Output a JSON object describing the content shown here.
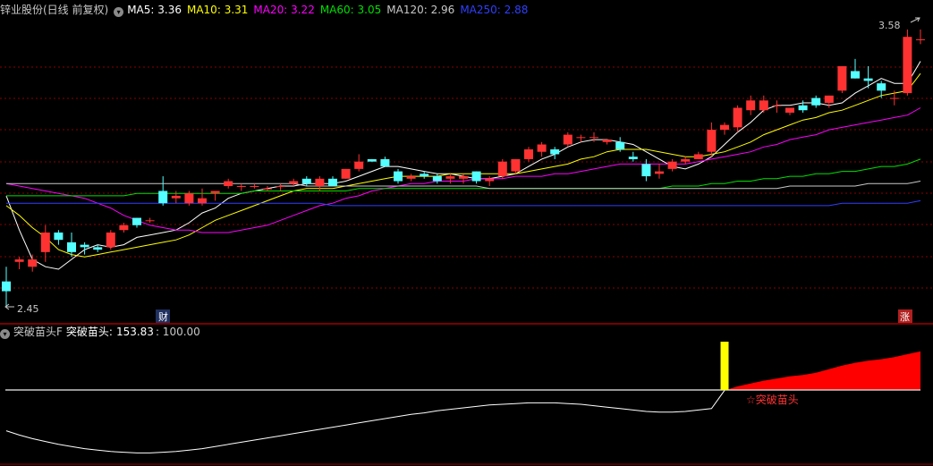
{
  "main_header": {
    "title": "锌业股份(日线 前复权)",
    "indicators": [
      {
        "label": "MA5:",
        "value": "3.36",
        "color": "#ffffff"
      },
      {
        "label": "MA10:",
        "value": "3.31",
        "color": "#ffff00"
      },
      {
        "label": "MA20:",
        "value": "3.22",
        "color": "#ff00ff"
      },
      {
        "label": "MA60:",
        "value": "3.05",
        "color": "#00e000"
      },
      {
        "label": "MA120:",
        "value": "2.96",
        "color": "#c8c8c8"
      },
      {
        "label": "MA250:",
        "value": "2.88",
        "color": "#2f3fff"
      }
    ]
  },
  "sub_header": {
    "name": "突破苗头F",
    "series_label": "突破苗头:",
    "value": "153.83",
    "ref_value": ": 100.00"
  },
  "markers": {
    "high_label": "3.58",
    "low_label": "2.45",
    "finance_badge": "财",
    "limit_up_badge": "涨",
    "signal_label": "☆突破苗头"
  },
  "colors": {
    "up": "#ff3232",
    "down": "#54ffff",
    "grid": "#8b0000",
    "separator": "#a00000",
    "signal_bar": "#ffff00",
    "area": "#ff0000"
  },
  "chart_data": [
    {
      "type": "candlestick",
      "title": "锌业股份(日线 前复权)",
      "ylim": [
        2.45,
        3.58
      ],
      "candles": [
        [
          2.55,
          2.61,
          2.45,
          2.51
        ],
        [
          2.63,
          2.65,
          2.6,
          2.64
        ],
        [
          2.61,
          2.66,
          2.59,
          2.64
        ],
        [
          2.67,
          2.78,
          2.63,
          2.75
        ],
        [
          2.75,
          2.76,
          2.7,
          2.72
        ],
        [
          2.71,
          2.75,
          2.65,
          2.67
        ],
        [
          2.7,
          2.71,
          2.66,
          2.69
        ],
        [
          2.69,
          2.7,
          2.67,
          2.68
        ],
        [
          2.69,
          2.76,
          2.68,
          2.75
        ],
        [
          2.76,
          2.79,
          2.75,
          2.78
        ],
        [
          2.81,
          2.81,
          2.77,
          2.78
        ],
        [
          2.8,
          2.81,
          2.79,
          2.8
        ],
        [
          2.92,
          2.98,
          2.86,
          2.87
        ],
        [
          2.89,
          2.92,
          2.87,
          2.9
        ],
        [
          2.87,
          2.92,
          2.86,
          2.91
        ],
        [
          2.87,
          2.93,
          2.86,
          2.89
        ],
        [
          2.91,
          2.92,
          2.88,
          2.92
        ],
        [
          2.94,
          2.97,
          2.93,
          2.96
        ],
        [
          2.94,
          2.95,
          2.92,
          2.94
        ],
        [
          2.94,
          2.95,
          2.93,
          2.94
        ],
        [
          2.93,
          2.94,
          2.92,
          2.93
        ],
        [
          2.94,
          2.95,
          2.92,
          2.94
        ],
        [
          2.95,
          2.97,
          2.94,
          2.96
        ],
        [
          2.97,
          2.98,
          2.94,
          2.95
        ],
        [
          2.94,
          2.98,
          2.92,
          2.97
        ],
        [
          2.97,
          2.98,
          2.95,
          2.94
        ],
        [
          2.97,
          3.01,
          2.97,
          3.01
        ],
        [
          3.01,
          3.07,
          3.0,
          3.04
        ],
        [
          3.05,
          3.05,
          3.04,
          3.04
        ],
        [
          3.05,
          3.06,
          3.02,
          3.02
        ],
        [
          3.0,
          3.01,
          2.95,
          2.96
        ],
        [
          2.97,
          2.99,
          2.96,
          2.98
        ],
        [
          2.99,
          3.0,
          2.97,
          2.98
        ],
        [
          2.98,
          2.99,
          2.95,
          2.96
        ],
        [
          2.97,
          2.99,
          2.95,
          2.98
        ],
        [
          2.97,
          2.99,
          2.95,
          2.98
        ],
        [
          3.0,
          3.0,
          2.95,
          2.96
        ],
        [
          2.96,
          2.98,
          2.94,
          2.97
        ],
        [
          2.98,
          3.05,
          2.97,
          3.04
        ],
        [
          3.0,
          3.05,
          2.99,
          3.05
        ],
        [
          3.05,
          3.1,
          3.04,
          3.09
        ],
        [
          3.08,
          3.12,
          3.06,
          3.11
        ],
        [
          3.09,
          3.1,
          3.05,
          3.07
        ],
        [
          3.11,
          3.16,
          3.1,
          3.15
        ],
        [
          3.14,
          3.15,
          3.12,
          3.14
        ],
        [
          3.14,
          3.16,
          3.12,
          3.14
        ],
        [
          3.12,
          3.13,
          3.11,
          3.13
        ],
        [
          3.12,
          3.14,
          3.08,
          3.09
        ],
        [
          3.06,
          3.08,
          3.04,
          3.05
        ],
        [
          3.03,
          3.05,
          2.96,
          2.98
        ],
        [
          2.99,
          3.03,
          2.97,
          3.0
        ],
        [
          3.01,
          3.05,
          3.0,
          3.04
        ],
        [
          3.04,
          3.06,
          3.03,
          3.05
        ],
        [
          3.05,
          3.08,
          3.05,
          3.07
        ],
        [
          3.08,
          3.2,
          3.06,
          3.17
        ],
        [
          3.17,
          3.2,
          3.15,
          3.19
        ],
        [
          3.18,
          3.27,
          3.16,
          3.26
        ],
        [
          3.25,
          3.31,
          3.23,
          3.29
        ],
        [
          3.25,
          3.31,
          3.24,
          3.29
        ],
        [
          3.27,
          3.29,
          3.24,
          3.27
        ],
        [
          3.24,
          3.26,
          3.23,
          3.26
        ],
        [
          3.27,
          3.29,
          3.24,
          3.25
        ],
        [
          3.3,
          3.31,
          3.26,
          3.27
        ],
        [
          3.28,
          3.31,
          3.26,
          3.31
        ],
        [
          3.33,
          3.43,
          3.32,
          3.43
        ],
        [
          3.41,
          3.46,
          3.38,
          3.38
        ],
        [
          3.38,
          3.43,
          3.34,
          3.37
        ],
        [
          3.36,
          3.37,
          3.3,
          3.33
        ],
        [
          3.3,
          3.33,
          3.27,
          3.3
        ],
        [
          3.32,
          3.58,
          3.31,
          3.55
        ],
        [
          3.54,
          3.58,
          3.52,
          3.54
        ]
      ],
      "series": [
        {
          "name": "MA5",
          "values": [
            2.9,
            2.76,
            2.64,
            2.61,
            2.6,
            2.64,
            2.68,
            2.7,
            2.69,
            2.7,
            2.73,
            2.74,
            2.75,
            2.76,
            2.79,
            2.83,
            2.85,
            2.89,
            2.91,
            2.92,
            2.93,
            2.94,
            2.94,
            2.95,
            2.95,
            2.95,
            2.96,
            2.98,
            3.0,
            3.02,
            3.02,
            3.01,
            3.0,
            2.99,
            2.99,
            2.98,
            2.97,
            2.97,
            2.98,
            2.99,
            3.02,
            3.05,
            3.07,
            3.1,
            3.12,
            3.13,
            3.13,
            3.12,
            3.11,
            3.08,
            3.05,
            3.02,
            3.01,
            3.03,
            3.06,
            3.11,
            3.16,
            3.2,
            3.25,
            3.27,
            3.27,
            3.28,
            3.28,
            3.27,
            3.28,
            3.32,
            3.35,
            3.38,
            3.36,
            3.36,
            3.45
          ]
        },
        {
          "name": "MA10",
          "values": [
            2.86,
            2.82,
            2.77,
            2.73,
            2.68,
            2.66,
            2.65,
            2.66,
            2.67,
            2.68,
            2.69,
            2.7,
            2.71,
            2.72,
            2.74,
            2.77,
            2.8,
            2.82,
            2.84,
            2.86,
            2.88,
            2.9,
            2.92,
            2.93,
            2.93,
            2.93,
            2.94,
            2.95,
            2.96,
            2.97,
            2.98,
            2.98,
            2.98,
            2.98,
            2.99,
            2.99,
            2.99,
            2.99,
            2.99,
            2.99,
            3.0,
            3.01,
            3.02,
            3.03,
            3.05,
            3.06,
            3.08,
            3.09,
            3.09,
            3.09,
            3.08,
            3.07,
            3.06,
            3.06,
            3.07,
            3.08,
            3.1,
            3.12,
            3.15,
            3.17,
            3.19,
            3.21,
            3.22,
            3.24,
            3.25,
            3.27,
            3.29,
            3.31,
            3.32,
            3.33,
            3.4
          ]
        },
        {
          "name": "MA20",
          "values": [
            2.95,
            2.94,
            2.93,
            2.92,
            2.91,
            2.9,
            2.89,
            2.87,
            2.85,
            2.82,
            2.8,
            2.78,
            2.77,
            2.76,
            2.76,
            2.75,
            2.75,
            2.75,
            2.76,
            2.77,
            2.78,
            2.8,
            2.82,
            2.84,
            2.86,
            2.87,
            2.89,
            2.9,
            2.92,
            2.93,
            2.94,
            2.95,
            2.95,
            2.96,
            2.96,
            2.96,
            2.97,
            2.97,
            2.97,
            2.98,
            2.98,
            2.98,
            2.99,
            2.99,
            3.0,
            3.01,
            3.02,
            3.03,
            3.03,
            3.03,
            3.03,
            3.03,
            3.03,
            3.04,
            3.05,
            3.06,
            3.07,
            3.08,
            3.1,
            3.11,
            3.13,
            3.14,
            3.15,
            3.17,
            3.18,
            3.19,
            3.2,
            3.21,
            3.22,
            3.23,
            3.26
          ]
        },
        {
          "name": "MA60",
          "values": [
            2.9,
            2.9,
            2.9,
            2.9,
            2.9,
            2.9,
            2.9,
            2.9,
            2.9,
            2.9,
            2.91,
            2.91,
            2.91,
            2.91,
            2.91,
            2.91,
            2.91,
            2.91,
            2.91,
            2.92,
            2.92,
            2.92,
            2.92,
            2.92,
            2.92,
            2.92,
            2.92,
            2.93,
            2.93,
            2.93,
            2.93,
            2.93,
            2.93,
            2.93,
            2.93,
            2.93,
            2.93,
            2.93,
            2.93,
            2.93,
            2.93,
            2.93,
            2.93,
            2.93,
            2.93,
            2.93,
            2.93,
            2.93,
            2.93,
            2.93,
            2.93,
            2.94,
            2.94,
            2.94,
            2.95,
            2.95,
            2.96,
            2.96,
            2.97,
            2.97,
            2.98,
            2.98,
            2.99,
            2.99,
            3.0,
            3.0,
            3.01,
            3.02,
            3.02,
            3.03,
            3.05
          ]
        },
        {
          "name": "MA120",
          "values": [
            2.95,
            2.95,
            2.95,
            2.95,
            2.95,
            2.95,
            2.95,
            2.95,
            2.95,
            2.95,
            2.95,
            2.95,
            2.95,
            2.95,
            2.95,
            2.95,
            2.95,
            2.95,
            2.95,
            2.95,
            2.95,
            2.95,
            2.95,
            2.94,
            2.94,
            2.94,
            2.94,
            2.94,
            2.94,
            2.94,
            2.94,
            2.94,
            2.94,
            2.94,
            2.94,
            2.94,
            2.94,
            2.93,
            2.93,
            2.93,
            2.93,
            2.93,
            2.93,
            2.93,
            2.93,
            2.93,
            2.93,
            2.93,
            2.93,
            2.93,
            2.93,
            2.93,
            2.93,
            2.93,
            2.93,
            2.93,
            2.93,
            2.93,
            2.93,
            2.93,
            2.94,
            2.94,
            2.94,
            2.94,
            2.94,
            2.94,
            2.95,
            2.95,
            2.95,
            2.95,
            2.96
          ]
        },
        {
          "name": "MA250",
          "values": [
            2.87,
            2.87,
            2.87,
            2.87,
            2.87,
            2.87,
            2.87,
            2.87,
            2.87,
            2.87,
            2.87,
            2.87,
            2.87,
            2.87,
            2.87,
            2.87,
            2.87,
            2.87,
            2.87,
            2.87,
            2.87,
            2.87,
            2.87,
            2.87,
            2.87,
            2.86,
            2.86,
            2.86,
            2.86,
            2.86,
            2.86,
            2.86,
            2.86,
            2.86,
            2.86,
            2.86,
            2.86,
            2.86,
            2.86,
            2.86,
            2.86,
            2.86,
            2.86,
            2.86,
            2.86,
            2.86,
            2.86,
            2.86,
            2.86,
            2.86,
            2.86,
            2.86,
            2.86,
            2.86,
            2.86,
            2.86,
            2.86,
            2.86,
            2.86,
            2.86,
            2.86,
            2.86,
            2.86,
            2.86,
            2.87,
            2.87,
            2.87,
            2.87,
            2.87,
            2.87,
            2.88
          ]
        }
      ]
    },
    {
      "type": "line",
      "title": "突破苗头F",
      "ylim": [
        0,
        160
      ],
      "reference_line": 100.0,
      "signal_index": 55,
      "series": [
        {
          "name": "突破苗头",
          "values": [
            43,
            37,
            32,
            28,
            24,
            21,
            18,
            16,
            14,
            13,
            12,
            12,
            13,
            14,
            16,
            18,
            21,
            24,
            27,
            30,
            33,
            36,
            39,
            42,
            45,
            48,
            51,
            54,
            57,
            60,
            63,
            66,
            68,
            71,
            73,
            75,
            77,
            79,
            80,
            81,
            82,
            82,
            82,
            81,
            80,
            78,
            76,
            74,
            72,
            70,
            69,
            69,
            70,
            72,
            74,
            99.5,
            105,
            109,
            113,
            116,
            119,
            121,
            124,
            129,
            134,
            138,
            141,
            143,
            146,
            150,
            153.83
          ]
        }
      ]
    }
  ]
}
